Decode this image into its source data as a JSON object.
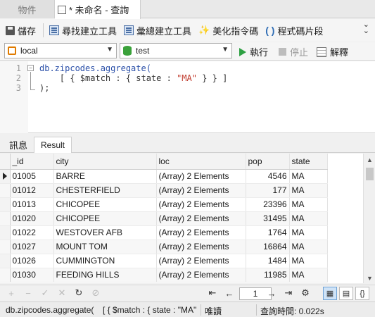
{
  "tabs": {
    "objects": "物件",
    "query": "* 未命名 - 查詢"
  },
  "toolbar": {
    "save": "儲存",
    "find_builder": "尋找建立工具",
    "aggregate_builder": "彙總建立工具",
    "beautify": "美化指令碼",
    "snippet": "程式碼片段"
  },
  "connection": {
    "connection_value": "local",
    "database_value": "test",
    "run": "執行",
    "stop": "停止",
    "explain": "解釋"
  },
  "editor": {
    "lines": [
      {
        "num": "1",
        "text": "db.zipcodes.aggregate("
      },
      {
        "num": "2",
        "text_prefix": "    [ { $match : { state : ",
        "text_string": "\"MA\"",
        "text_suffix": " } } ]"
      },
      {
        "num": "3",
        "text": ");"
      }
    ]
  },
  "result_tabs": {
    "info": "訊息",
    "result": "Result"
  },
  "grid": {
    "columns": [
      "_id",
      "city",
      "loc",
      "pop",
      "state"
    ],
    "rows": [
      {
        "id": "01005",
        "city": "BARRE",
        "loc": "(Array) 2 Elements",
        "pop": "4546",
        "state": "MA"
      },
      {
        "id": "01012",
        "city": "CHESTERFIELD",
        "loc": "(Array) 2 Elements",
        "pop": "177",
        "state": "MA"
      },
      {
        "id": "01013",
        "city": "CHICOPEE",
        "loc": "(Array) 2 Elements",
        "pop": "23396",
        "state": "MA"
      },
      {
        "id": "01020",
        "city": "CHICOPEE",
        "loc": "(Array) 2 Elements",
        "pop": "31495",
        "state": "MA"
      },
      {
        "id": "01022",
        "city": "WESTOVER AFB",
        "loc": "(Array) 2 Elements",
        "pop": "1764",
        "state": "MA"
      },
      {
        "id": "01027",
        "city": "MOUNT TOM",
        "loc": "(Array) 2 Elements",
        "pop": "16864",
        "state": "MA"
      },
      {
        "id": "01026",
        "city": "CUMMINGTON",
        "loc": "(Array) 2 Elements",
        "pop": "1484",
        "state": "MA"
      },
      {
        "id": "01030",
        "city": "FEEDING HILLS",
        "loc": "(Array) 2 Elements",
        "pop": "11985",
        "state": "MA"
      }
    ]
  },
  "navbar": {
    "page": "1"
  },
  "status": {
    "query_text": "db.zipcodes.aggregate(",
    "query_text2": "[ { $match : { state : \"MA\"",
    "mode": "唯讀",
    "query_time": "查詢時間: 0.022s"
  },
  "colors": {
    "accent": "#2f6db5",
    "run_green": "#2ea043",
    "string_red": "#c0392b"
  }
}
